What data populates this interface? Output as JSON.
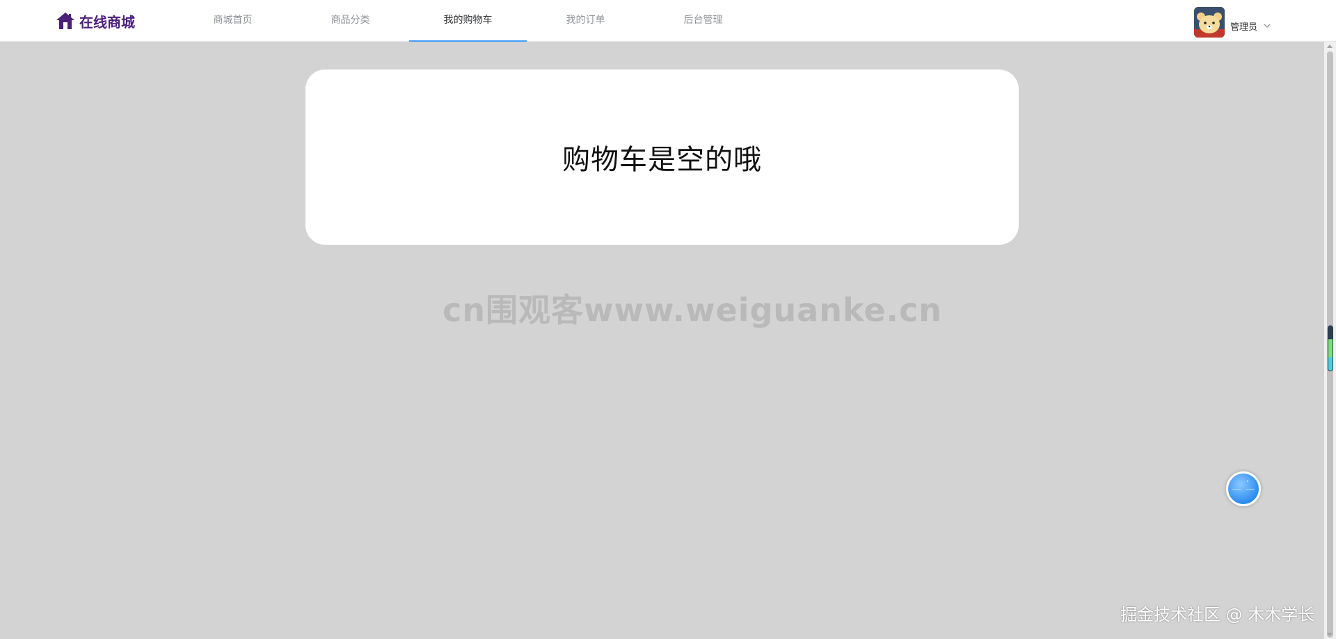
{
  "header": {
    "logo_text": "在线商城",
    "nav": [
      {
        "label": "商城首页",
        "active": false
      },
      {
        "label": "商品分类",
        "active": false
      },
      {
        "label": "我的购物车",
        "active": true
      },
      {
        "label": "我的订单",
        "active": false
      },
      {
        "label": "后台管理",
        "active": false
      }
    ],
    "user": {
      "name": "管理员",
      "avatar_icon": "bear-avatar-icon",
      "menu_icon": "chevron-down-icon"
    }
  },
  "main": {
    "empty_message": "购物车是空的哦"
  },
  "overlays": {
    "watermark": "cn围观客www.weiguanke.cn",
    "footer_watermark": "掘金技术社区 @ 木木学长"
  },
  "colors": {
    "accent": "#409eff",
    "brand": "#4b1f7a",
    "background": "#d3d3d3"
  }
}
